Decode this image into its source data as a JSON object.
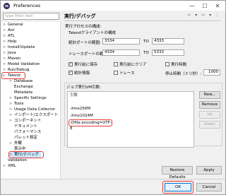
{
  "window": {
    "title": "Preferences"
  },
  "window_controls": {
    "minimize": "—",
    "maximize": "☐",
    "close": "✕"
  },
  "filter": {
    "placeholder": "type filter text"
  },
  "tree": {
    "items": [
      {
        "label": "General",
        "arrow": ">"
      },
      {
        "label": "Ant",
        "arrow": ">"
      },
      {
        "label": "ATL",
        "arrow": ">"
      },
      {
        "label": "Help",
        "arrow": ">"
      },
      {
        "label": "Install/Update",
        "arrow": ">"
      },
      {
        "label": "Java",
        "arrow": ">"
      },
      {
        "label": "Maven",
        "arrow": ">"
      },
      {
        "label": "Model Validation",
        "arrow": ">"
      },
      {
        "label": "Run/Debug",
        "arrow": ">"
      },
      {
        "label": "Talend",
        "arrow": "v"
      },
      {
        "label": "Database",
        "arrow": ">"
      },
      {
        "label": "Exchange",
        "arrow": ""
      },
      {
        "label": "Metadata",
        "arrow": ""
      },
      {
        "label": "Specific Settings",
        "arrow": ">"
      },
      {
        "label": "Tools",
        "arrow": ">"
      },
      {
        "label": "Usage Data Collector",
        "arrow": ">"
      },
      {
        "label": "インポート/エクスポート",
        "arrow": ">"
      },
      {
        "label": "コンポーネント",
        "arrow": ">"
      },
      {
        "label": "ドキュメント",
        "arrow": ""
      },
      {
        "label": "パフォーマンス",
        "arrow": ""
      },
      {
        "label": "パレット設定",
        "arrow": ""
      },
      {
        "label": "外観",
        "arrow": ">"
      },
      {
        "label": "表示中",
        "arrow": ""
      },
      {
        "label": "実行/デバッグ",
        "arrow": ">"
      },
      {
        "label": "Validation",
        "arrow": ""
      },
      {
        "label": "XML",
        "arrow": ">"
      }
    ]
  },
  "header": {
    "title": "実行/デバッグ",
    "nav": "⇦ ▾ ⇨ ▾ ⋮"
  },
  "process": {
    "group_label": "実行プロセスの構成:",
    "client_label": "Talendクライアントの構成",
    "stats_label": "統計ポートの範囲:",
    "stats_from": "3334",
    "stats_to": "4333",
    "trace_label": "トレースポートの範囲:",
    "trace_from": "4334",
    "trace_to": "5333",
    "to_label": "TO"
  },
  "checkboxes": {
    "save_before_run": "実行前に保存",
    "clear_before_run": "実行前にクリア",
    "exec_time": "実行時間",
    "statistics": "統計情報",
    "trace": "トレース",
    "pause_label": "停止時間（ミリ秒）:",
    "pause_value": "1000"
  },
  "jvm": {
    "group_label": "ジョブ実行VM引数:",
    "list_header": "引数",
    "args": [
      "-Xms256M",
      "-Xmx1024M",
      "-Dfile.encoding=UTF-8"
    ]
  },
  "side_buttons": {
    "new": "New...",
    "remove": "Remove",
    "up": "Up",
    "down": "Down"
  },
  "footer": {
    "restore": "Restore Defaults",
    "apply": "Apply",
    "ok": "OK",
    "cancel": "Cancel"
  },
  "colors": {
    "highlight": "#e53935",
    "selection": "#cce8ff"
  }
}
